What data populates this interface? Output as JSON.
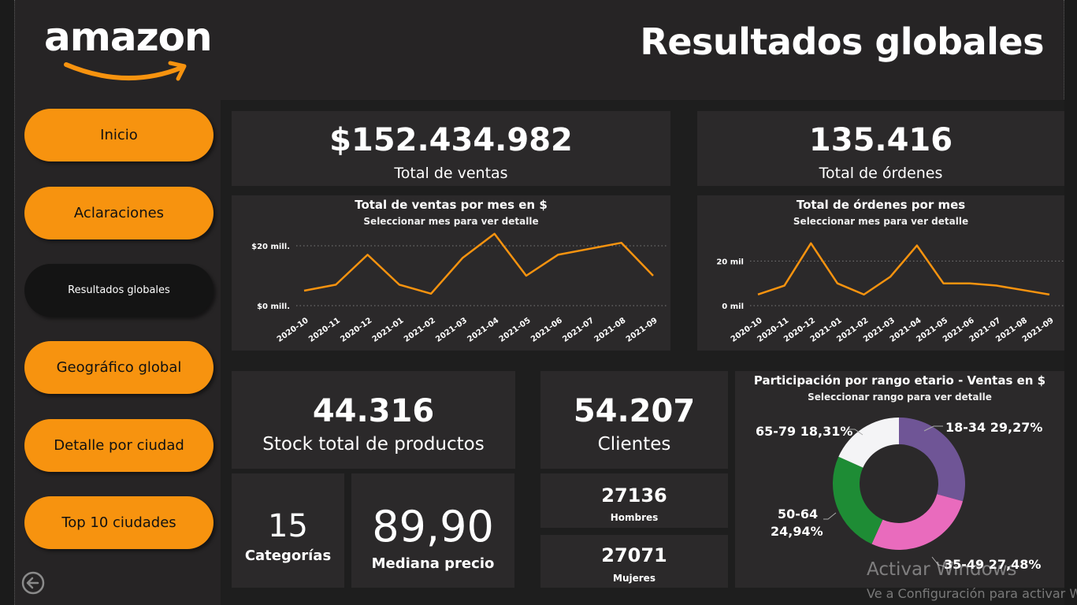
{
  "header": {
    "logo_text": "amazon",
    "title": "Resultados globales"
  },
  "nav": {
    "items": [
      {
        "label": "Inicio"
      },
      {
        "label": "Aclaraciones"
      },
      {
        "label": "Resultados globales"
      },
      {
        "label": "Geográfico global"
      },
      {
        "label": "Detalle por ciudad"
      },
      {
        "label": "Top 10 ciudades"
      }
    ],
    "active_index": 2,
    "back_icon": "back-arrow-icon"
  },
  "kpis": {
    "total_sales": {
      "value": "$152.434.982",
      "label": "Total de ventas"
    },
    "total_orders": {
      "value": "135.416",
      "label": "Total de órdenes"
    },
    "stock": {
      "value": "44.316",
      "label": "Stock total de productos"
    },
    "clients": {
      "value": "54.207",
      "label": "Clientes"
    },
    "categories": {
      "value": "15",
      "label": "Categorías"
    },
    "median_price": {
      "value": "89,90",
      "label": "Mediana precio"
    },
    "men": {
      "value": "27136",
      "label": "Hombres"
    },
    "women": {
      "value": "27071",
      "label": "Mujeres"
    }
  },
  "charts": {
    "sales": {
      "title": "Total de ventas por mes en $",
      "subtitle": "Seleccionar mes para ver detalle",
      "y_ticks": [
        "$20 mill.",
        "$0 mill."
      ]
    },
    "orders": {
      "title": "Total de órdenes por mes",
      "subtitle": "Seleccionar mes para ver detalle",
      "y_ticks": [
        "20 mil",
        "0 mil"
      ]
    },
    "age": {
      "title": "Participación por rango etario - Ventas en $",
      "subtitle": "Seleccionar rango para ver detalle",
      "labels": {
        "s1": "18-34 29,27%",
        "s2": "35-49 27,48%",
        "s3a": "50-64",
        "s3b": "24,94%",
        "s4": "65-79 18,31%"
      }
    }
  },
  "chart_data": [
    {
      "type": "line",
      "title": "Total de ventas por mes en $",
      "x": [
        "2020-10",
        "2020-11",
        "2020-12",
        "2021-01",
        "2021-02",
        "2021-03",
        "2021-04",
        "2021-05",
        "2021-06",
        "2021-07",
        "2021-08",
        "2021-09"
      ],
      "series": [
        {
          "values": [
            5,
            7,
            17,
            7,
            4,
            16,
            24,
            10,
            17,
            19,
            21,
            10
          ]
        }
      ],
      "ylabel": "",
      "y_unit": "mill.",
      "ylim": [
        0,
        30
      ],
      "color": "#f7930f",
      "grid": true
    },
    {
      "type": "line",
      "title": "Total de órdenes por mes",
      "x": [
        "2020-10",
        "2020-11",
        "2020-12",
        "2021-01",
        "2021-02",
        "2021-03",
        "2021-04",
        "2021-05",
        "2021-06",
        "2021-07",
        "2021-08",
        "2021-09"
      ],
      "series": [
        {
          "values": [
            5,
            9,
            28,
            10,
            5,
            13,
            27,
            10,
            10,
            9,
            7,
            5
          ]
        }
      ],
      "ylabel": "",
      "y_unit": "mil",
      "ylim": [
        0,
        35
      ],
      "color": "#f7930f",
      "grid": true
    },
    {
      "type": "pie",
      "title": "Participación por rango etario - Ventas en $",
      "categories": [
        "18-34",
        "35-49",
        "50-64",
        "65-79"
      ],
      "values": [
        29.27,
        27.48,
        24.94,
        18.31
      ],
      "colors": [
        "#6f5596",
        "#e96bbd",
        "#1e8c35",
        "#f4f4f6"
      ],
      "donut": true
    }
  ],
  "watermark": {
    "line1": "Activar Windows",
    "line2": "Ve a Configuración para activar W"
  },
  "colors": {
    "accent": "#f7930f",
    "background": "#262425",
    "card": "#2b292a"
  }
}
